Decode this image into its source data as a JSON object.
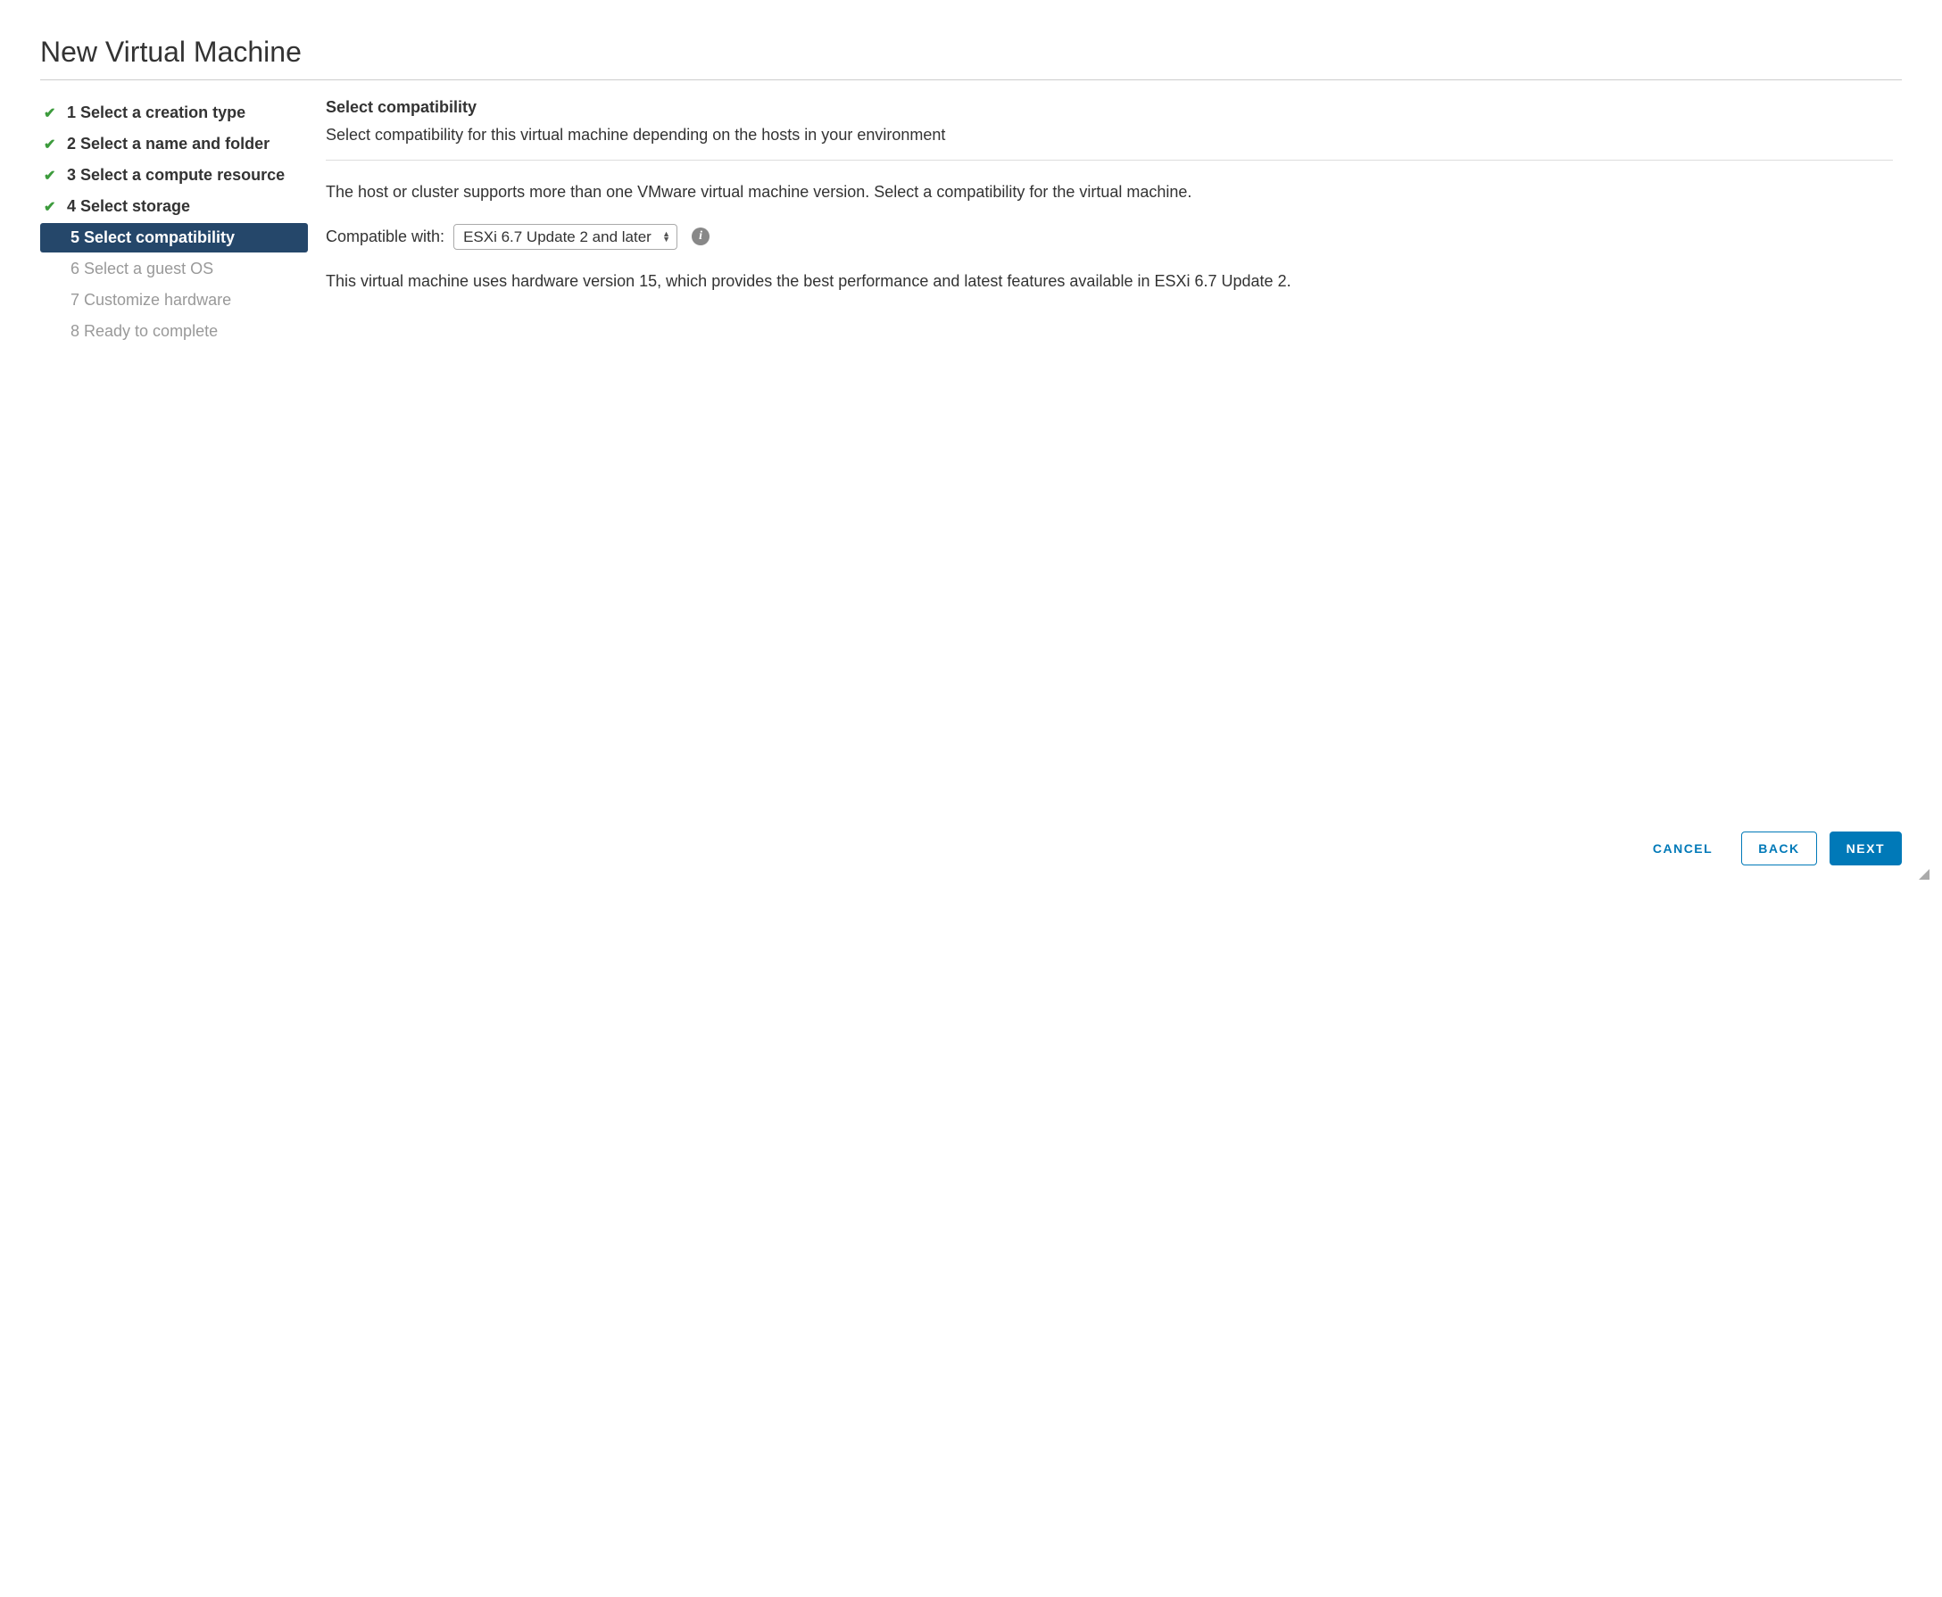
{
  "dialog": {
    "title": "New Virtual Machine"
  },
  "wizard": {
    "steps": [
      {
        "label": "1 Select a creation type"
      },
      {
        "label": "2 Select a name and folder"
      },
      {
        "label": "3 Select a compute resource"
      },
      {
        "label": "4 Select storage"
      },
      {
        "label": "5 Select compatibility"
      },
      {
        "label": "6 Select a guest OS"
      },
      {
        "label": "7 Customize hardware"
      },
      {
        "label": "8 Ready to complete"
      }
    ]
  },
  "content": {
    "heading": "Select compatibility",
    "subheading": "Select compatibility for this virtual machine depending on the hosts in your environment",
    "description": "The host or cluster supports more than one VMware virtual machine version. Select a compatibility for the virtual machine.",
    "compatibility_label": "Compatible with:",
    "compatibility_value": "ESXi 6.7 Update 2 and later",
    "info_text": "This virtual machine uses hardware version 15, which provides the best performance and latest features available in ESXi 6.7 Update 2."
  },
  "footer": {
    "cancel": "CANCEL",
    "back": "BACK",
    "next": "NEXT"
  }
}
